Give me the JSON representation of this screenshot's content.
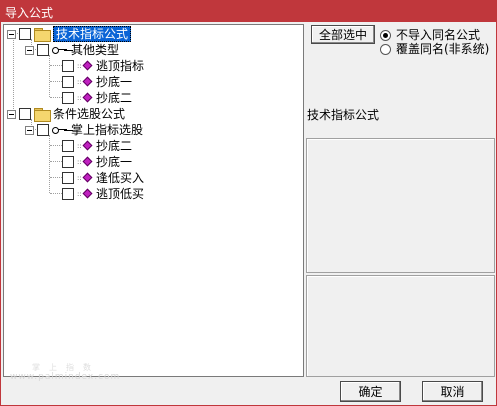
{
  "window": {
    "title": "导入公式"
  },
  "tree": {
    "root1": {
      "label": "技术指标公式",
      "group": {
        "label": "其他类型",
        "items": [
          "逃顶指标",
          "抄底一",
          "抄底二"
        ]
      }
    },
    "root2": {
      "label": "条件选股公式",
      "group": {
        "label": "掌上指标选股",
        "items": [
          "抄底二",
          "抄底一",
          "逢低买入",
          "逃顶低买"
        ]
      }
    }
  },
  "options": {
    "select_all_label": "全部选中",
    "radio_no_import": "不导入同名公式",
    "radio_overwrite": "覆盖同名(非系统)",
    "selected": "radio_no_import"
  },
  "info": {
    "category_label": "技术指标公式"
  },
  "watermark": {
    "text": "www.palmindex.com",
    "cn_text": "掌上指数"
  },
  "buttons": {
    "ok": "确定",
    "cancel": "取消"
  },
  "colors": {
    "title_bar": "#c0373c",
    "selection": "#0a64d6",
    "formula_gem": "#c020c0"
  }
}
